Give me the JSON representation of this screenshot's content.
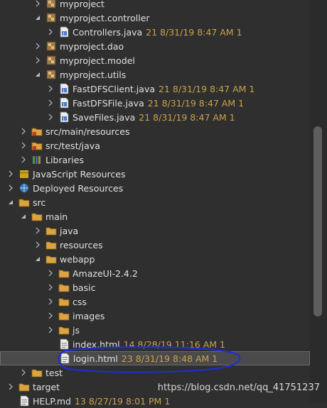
{
  "tree": [
    {
      "label": "myproject",
      "icon": "package-icon",
      "indent": 64,
      "twisty": "collapsed",
      "meta": ""
    },
    {
      "label": "myproject.controller",
      "icon": "package-icon",
      "indent": 64,
      "twisty": "expanded",
      "meta": ""
    },
    {
      "label": "Controllers.java",
      "icon": "java-file-icon",
      "indent": 82,
      "twisty": "collapsed",
      "meta": "21  8/31/19 8:47 AM  1"
    },
    {
      "label": "myproject.dao",
      "icon": "package-icon",
      "indent": 64,
      "twisty": "collapsed",
      "meta": ""
    },
    {
      "label": "myproject.model",
      "icon": "package-icon",
      "indent": 64,
      "twisty": "collapsed",
      "meta": ""
    },
    {
      "label": "myproject.utils",
      "icon": "package-icon",
      "indent": 64,
      "twisty": "expanded",
      "meta": ""
    },
    {
      "label": "FastDFSClient.java",
      "icon": "java-file-icon",
      "indent": 82,
      "twisty": "collapsed",
      "meta": "21  8/31/19 8:47 AM  1"
    },
    {
      "label": "FastDFSFile.java",
      "icon": "java-file-icon",
      "indent": 82,
      "twisty": "collapsed",
      "meta": "21  8/31/19 8:47 AM  1"
    },
    {
      "label": "SaveFiles.java",
      "icon": "java-file-icon",
      "indent": 82,
      "twisty": "collapsed",
      "meta": "21  8/31/19 8:47 AM  1"
    },
    {
      "label": "src/main/resources",
      "icon": "source-folder-icon",
      "indent": 44,
      "twisty": "collapsed",
      "meta": ""
    },
    {
      "label": "src/test/java",
      "icon": "source-folder-icon",
      "indent": 44,
      "twisty": "collapsed",
      "meta": ""
    },
    {
      "label": "Libraries",
      "icon": "library-icon",
      "indent": 44,
      "twisty": "collapsed",
      "meta": ""
    },
    {
      "label": "JavaScript Resources",
      "icon": "js-resources-icon",
      "indent": 26,
      "twisty": "collapsed",
      "meta": ""
    },
    {
      "label": "Deployed Resources",
      "icon": "deployed-resources-icon",
      "indent": 26,
      "twisty": "collapsed",
      "meta": ""
    },
    {
      "label": "src",
      "icon": "folder-icon",
      "indent": 26,
      "twisty": "expanded",
      "meta": ""
    },
    {
      "label": "main",
      "icon": "folder-icon",
      "indent": 44,
      "twisty": "expanded",
      "meta": ""
    },
    {
      "label": "java",
      "icon": "folder-icon",
      "indent": 64,
      "twisty": "collapsed",
      "meta": ""
    },
    {
      "label": "resources",
      "icon": "folder-icon",
      "indent": 64,
      "twisty": "collapsed",
      "meta": ""
    },
    {
      "label": "webapp",
      "icon": "folder-icon",
      "indent": 64,
      "twisty": "expanded",
      "meta": ""
    },
    {
      "label": "AmazeUI-2.4.2",
      "icon": "folder-icon",
      "indent": 82,
      "twisty": "collapsed",
      "meta": ""
    },
    {
      "label": "basic",
      "icon": "folder-icon",
      "indent": 82,
      "twisty": "collapsed",
      "meta": ""
    },
    {
      "label": "css",
      "icon": "folder-icon",
      "indent": 82,
      "twisty": "collapsed",
      "meta": ""
    },
    {
      "label": "images",
      "icon": "folder-icon",
      "indent": 82,
      "twisty": "collapsed",
      "meta": ""
    },
    {
      "label": "js",
      "icon": "folder-icon",
      "indent": 82,
      "twisty": "collapsed",
      "meta": ""
    },
    {
      "label": "index.html",
      "icon": "html-file-icon",
      "indent": 82,
      "twisty": "none",
      "meta": "14  8/28/19 11:16 AM  1"
    },
    {
      "label": "login.html",
      "icon": "html-file-icon",
      "indent": 82,
      "twisty": "none",
      "meta": "23  8/31/19 8:48 AM  1",
      "selected": true
    },
    {
      "label": "test",
      "icon": "folder-icon",
      "indent": 44,
      "twisty": "collapsed",
      "meta": ""
    },
    {
      "label": "target",
      "icon": "folder-icon",
      "indent": 26,
      "twisty": "collapsed",
      "meta": ""
    },
    {
      "label": "HELP.md",
      "icon": "md-file-icon",
      "indent": 26,
      "twisty": "none",
      "meta": "13  8/27/19 8:01 PM  1"
    }
  ],
  "watermark": "https://blog.csdn.net/qq_41751237",
  "colors": {
    "background": "#2f2f2f",
    "meta": "#c8a24a",
    "text": "#e0e0e0",
    "annotation": "#1f2fd0",
    "folder": "#d9a441",
    "java": "#4a7bd0"
  }
}
